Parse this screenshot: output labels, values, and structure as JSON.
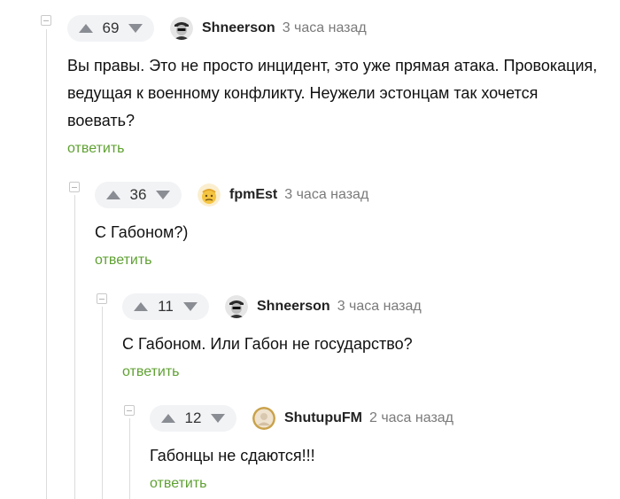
{
  "comments": [
    {
      "rating": "69",
      "author": "Shneerson",
      "time": "3 часа назад",
      "text": "Вы правы. Это не просто инцидент, это уже прямая атака. Провокация, ведущая к военному конфликту. Неужели эстонцам так хочется воевать?",
      "reply": "ответить"
    },
    {
      "rating": "36",
      "author": "fpmEst",
      "time": "3 часа назад",
      "text": "С Габоном?)",
      "reply": "ответить"
    },
    {
      "rating": "11",
      "author": "Shneerson",
      "time": "3 часа назад",
      "text": "С Габоном. Или Габон не государство?",
      "reply": "ответить"
    },
    {
      "rating": "12",
      "author": "ShutupuFM",
      "time": "2 часа назад",
      "text": "Габонцы не сдаются!!!",
      "reply": "ответить"
    }
  ],
  "colors": {
    "reply_link": "#5fa132",
    "pill_bg": "#f2f3f5",
    "thread_line": "#dcdcdc"
  },
  "icons": {
    "upvote": "triangle-up-icon",
    "downvote": "triangle-down-icon",
    "collapse": "minus-square-icon"
  }
}
